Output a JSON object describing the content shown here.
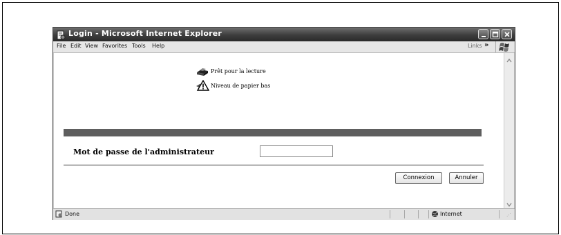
{
  "window": {
    "title": "Login - Microsoft Internet Explorer"
  },
  "menu": {
    "items": [
      "File",
      "Edit",
      "View",
      "Favorites",
      "Tools",
      "Help"
    ],
    "links_label": "Links"
  },
  "status_messages": {
    "ready": "Prêt pour la lecture",
    "low_paper": "Niveau de papier bas"
  },
  "form": {
    "password_label": "Mot de passe de l'administrateur",
    "password_value": "",
    "connect_label": "Connexion",
    "cancel_label": "Annuler"
  },
  "statusbar": {
    "left_text": "Done",
    "zone_text": "Internet"
  },
  "icons": {
    "app": "ie-page-icon",
    "printer": "printer-icon",
    "warning": "warning-icon",
    "globe": "globe-icon"
  }
}
